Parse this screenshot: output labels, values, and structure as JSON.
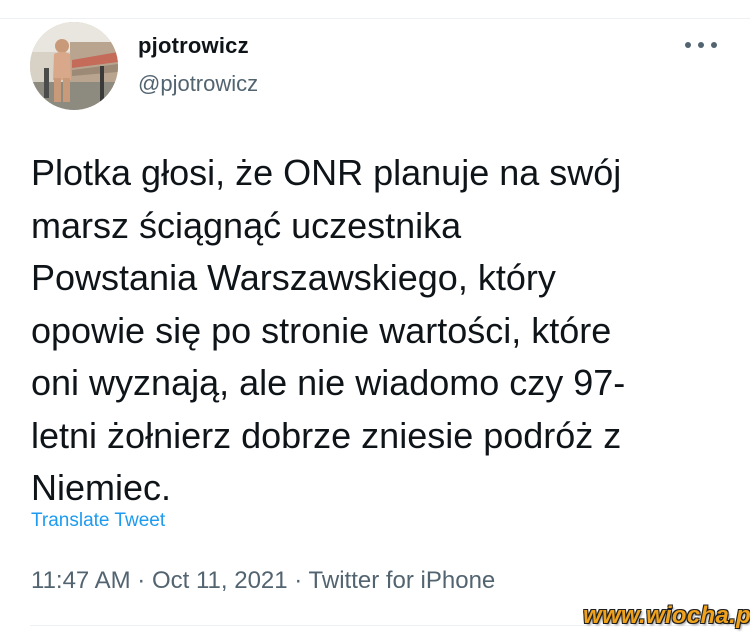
{
  "tweet": {
    "avatar_icon": "profile-photo",
    "display_name": "pjotrowicz",
    "handle": "@pjotrowicz",
    "more_icon": "more-horizontal-icon",
    "text": "Plotka głosi, że ONR planuje na swój\nmarsz ściągnąć uczestnika\nPowstania Warszawskiego, który\nopowie się po stronie wartości, które\noni wyznają, ale nie wiadomo czy 97-\nletni żołnierz dobrze zniesie podróż z\nNiemiec.",
    "translate_label": "Translate Tweet",
    "time": "11:47 AM",
    "separator": "·",
    "date": "Oct 11, 2021",
    "source": "Twitter for iPhone"
  },
  "watermark": "www.wiocha.pl",
  "colors": {
    "text": "#0f1419",
    "secondary": "#536471",
    "link": "#1d9bf0",
    "watermark": "#f0a21b"
  }
}
